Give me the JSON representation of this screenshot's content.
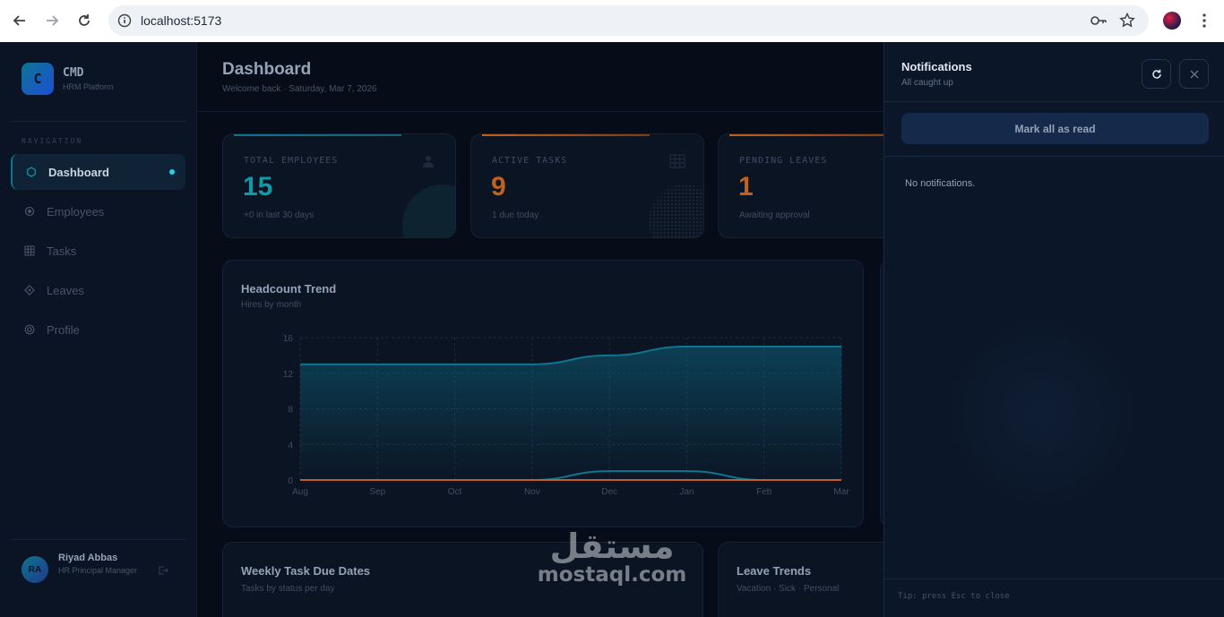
{
  "browser": {
    "url": "localhost:5173"
  },
  "sidebar": {
    "brand_letter": "C",
    "brand_name": "CMD",
    "brand_sub": "HRM Platform",
    "nav_heading": "NAVIGATION",
    "items": [
      {
        "label": "Dashboard",
        "icon": "hexagon-icon",
        "active": true
      },
      {
        "label": "Employees",
        "icon": "circle-target-icon",
        "active": false
      },
      {
        "label": "Tasks",
        "icon": "grid-icon",
        "active": false
      },
      {
        "label": "Leaves",
        "icon": "diamond-icon",
        "active": false
      },
      {
        "label": "Profile",
        "icon": "gear-circle-icon",
        "active": false
      }
    ],
    "user": {
      "initials": "RA",
      "name": "Riyad Abbas",
      "role": "HR Principal Manager"
    }
  },
  "header": {
    "title": "Dashboard",
    "subtitle": "Welcome back · Saturday, Mar 7, 2026"
  },
  "stats": [
    {
      "label": "TOTAL EMPLOYEES",
      "value": "15",
      "note": "+0 in last 30 days",
      "color": "#0e9aa7"
    },
    {
      "label": "ACTIVE TASKS",
      "value": "9",
      "note": "1 due today",
      "color": "#c2611f"
    },
    {
      "label": "PENDING LEAVES",
      "value": "1",
      "note": "Awaiting approval",
      "color": "#c2611f"
    }
  ],
  "chart_data": {
    "type": "area",
    "title": "Headcount Trend",
    "subtitle": "Hires by month",
    "categories": [
      "Aug",
      "Sep",
      "Oct",
      "Nov",
      "Dec",
      "Jan",
      "Feb",
      "Mar"
    ],
    "series": [
      {
        "values": [
          13,
          13,
          13,
          13,
          14,
          15,
          15,
          15
        ],
        "color": "#0e7490"
      },
      {
        "values": [
          0,
          0,
          0,
          0,
          1,
          1,
          0,
          0
        ],
        "color": "#0e7490"
      },
      {
        "values": [
          0,
          0,
          0,
          0,
          0,
          0,
          0,
          0
        ],
        "color": "#c2611f"
      }
    ],
    "ylim": [
      0,
      16
    ],
    "yticks": [
      "0",
      "4",
      "8",
      "12",
      "16"
    ],
    "grid": true
  },
  "bottom_cards": [
    {
      "title": "Weekly Task Due Dates",
      "subtitle": "Tasks by status per day"
    },
    {
      "title": "Leave Trends",
      "subtitle": "Vacation · Sick · Personal"
    }
  ],
  "watermark": {
    "arabic": "مستقل",
    "latin": "mostaql.com"
  },
  "notifications": {
    "title": "Notifications",
    "subtitle": "All caught up",
    "mark_all": "Mark all as read",
    "empty": "No notifications.",
    "tip": "Tip: press Esc to close"
  }
}
